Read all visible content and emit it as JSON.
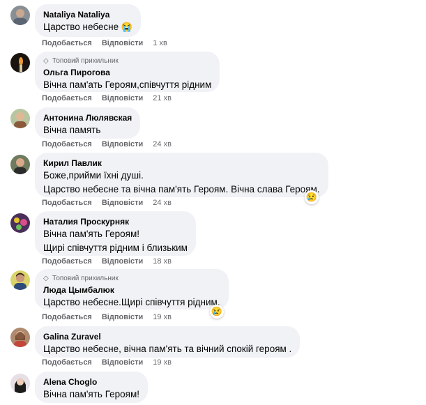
{
  "like_label": "Подобається",
  "reply_label": "Відповісти",
  "comments": [
    {
      "badge": "",
      "author": "Nataliya Nataliya",
      "lines": [
        "Царство небесне"
      ],
      "emoji": "😭",
      "time": "1 хв"
    },
    {
      "badge": "Топовий прихильник",
      "author": "Ольга Пирогова",
      "lines": [
        "Вічна пам'ать Героям,співчуття рідним"
      ],
      "time": "21 хв"
    },
    {
      "badge": "",
      "author": "Антонина Люлявская",
      "lines": [
        "Вічна память"
      ],
      "time": "24 хв"
    },
    {
      "badge": "",
      "author": "Кирил Павлик",
      "lines": [
        "Боже,прийми їхні душі.",
        "Царство небесне та вічна пам'ять Героям. Вічна слава Героям."
      ],
      "reaction": "😢",
      "time": "24 хв"
    },
    {
      "badge": "",
      "author": "Наталия Проскурняк",
      "lines": [
        "Вічна пам'ять Героям!",
        "Щирі співчуття рідним і близьким"
      ],
      "time": "18 хв"
    },
    {
      "badge": "Топовий прихильник",
      "author": "Люда Цымбалюк",
      "lines": [
        "Царство небесне.Щирі співчуття рідним."
      ],
      "reaction": "😢",
      "time": "19 хв"
    },
    {
      "badge": "",
      "author": "Galina Zuravel",
      "lines": [
        "Царство небесне, вічна пам'ять та вічний спокій героям ."
      ],
      "time": "19 хв"
    },
    {
      "badge": "",
      "author": "Alena Choglo",
      "lines": [
        "Вічна пам'ять Героям!"
      ]
    }
  ]
}
